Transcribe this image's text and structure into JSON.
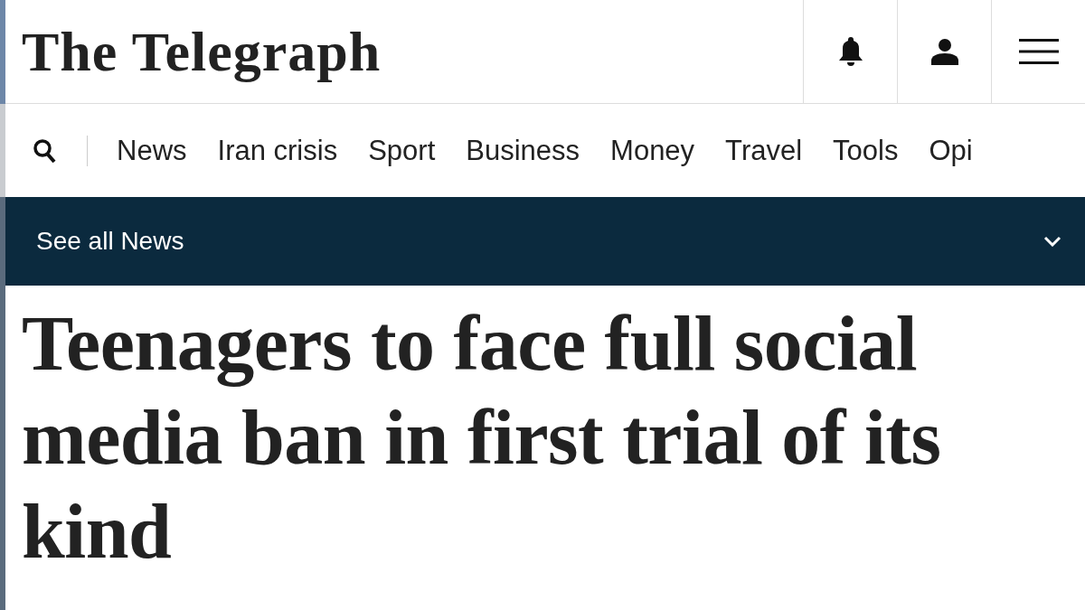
{
  "header": {
    "logo": "The Telegraph"
  },
  "nav": {
    "items": [
      "News",
      "Iran crisis",
      "Sport",
      "Business",
      "Money",
      "Travel",
      "Tools",
      "Opi"
    ]
  },
  "section_bar": {
    "label": "See all News"
  },
  "headline": "Teenagers to face full social media ban in first trial of its kind"
}
